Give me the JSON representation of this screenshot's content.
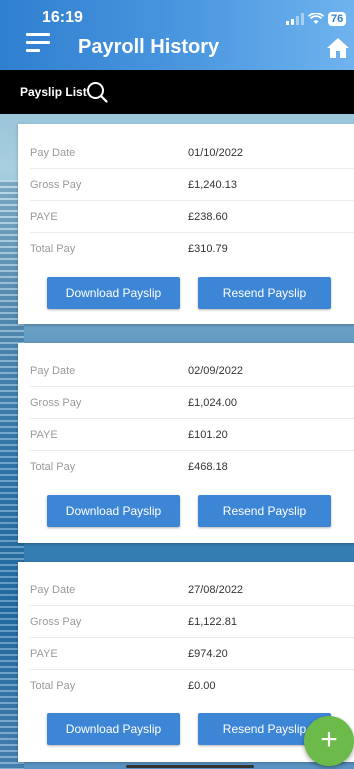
{
  "status_bar": {
    "time": "16:19",
    "battery": "76"
  },
  "header": {
    "title": "Payroll History"
  },
  "subbar": {
    "label": "Payslip List"
  },
  "labels": {
    "pay_date": "Pay Date",
    "gross_pay": "Gross Pay",
    "paye": "PAYE",
    "total_pay": "Total Pay",
    "download_button": "Download Payslip",
    "resend_button": "Resend Payslip"
  },
  "payslips": [
    {
      "pay_date": "01/10/2022",
      "gross_pay": "£1,240.13",
      "paye": "£238.60",
      "total_pay": "£310.79"
    },
    {
      "pay_date": "02/09/2022",
      "gross_pay": "£1,024.00",
      "paye": "£101.20",
      "total_pay": "£468.18"
    },
    {
      "pay_date": "27/08/2022",
      "gross_pay": "£1,122.81",
      "paye": "£974.20",
      "total_pay": "£0.00"
    }
  ],
  "fab": {
    "symbol": "+"
  },
  "colors": {
    "header": "#3d8ad8",
    "button": "#3d86d6",
    "fab": "#6cbb4a"
  },
  "icons": {
    "menu": "hamburger-icon",
    "home": "home-icon",
    "search": "search-icon",
    "add": "plus-icon"
  }
}
